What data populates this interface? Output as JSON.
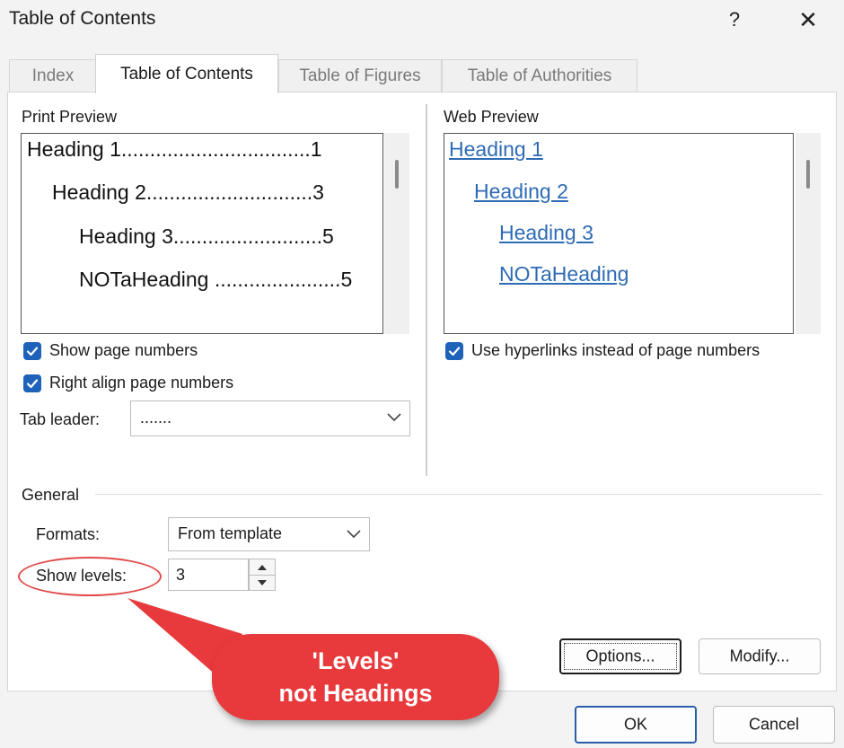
{
  "dialog": {
    "title": "Table of Contents",
    "help": "?",
    "close": "✕"
  },
  "tabs": [
    {
      "label": "Index",
      "active": false
    },
    {
      "label": "Table of Contents",
      "active": true
    },
    {
      "label": "Table of Figures",
      "active": false
    },
    {
      "label": "Table of Authorities",
      "active": false
    }
  ],
  "print_preview": {
    "label": "Print Preview",
    "lines": [
      "Heading 1.................................1",
      "Heading 2.............................3",
      "Heading 3..........................5",
      "NOTaHeading ......................5"
    ]
  },
  "web_preview": {
    "label": "Web Preview",
    "lines": [
      "Heading 1",
      "Heading 2",
      "Heading 3",
      "NOTaHeading"
    ]
  },
  "options": {
    "show_page_numbers": {
      "label": "Show page numbers",
      "checked": true
    },
    "right_align": {
      "label": "Right align page numbers",
      "checked": true
    },
    "use_hyperlinks": {
      "label": "Use hyperlinks instead of page numbers",
      "checked": true
    },
    "tab_leader": {
      "label": "Tab leader:",
      "value": "......."
    }
  },
  "general": {
    "label": "General",
    "formats": {
      "label": "Formats:",
      "value": "From template"
    },
    "show_levels": {
      "label": "Show levels:",
      "value": "3"
    }
  },
  "buttons": {
    "options": "Options...",
    "modify": "Modify...",
    "ok": "OK",
    "cancel": "Cancel"
  },
  "callout": {
    "line1": "'Levels'",
    "line2": "not Headings"
  },
  "colors": {
    "accent": "#1e63b9",
    "link": "#2e6bb5",
    "callout": "#e8393c"
  }
}
